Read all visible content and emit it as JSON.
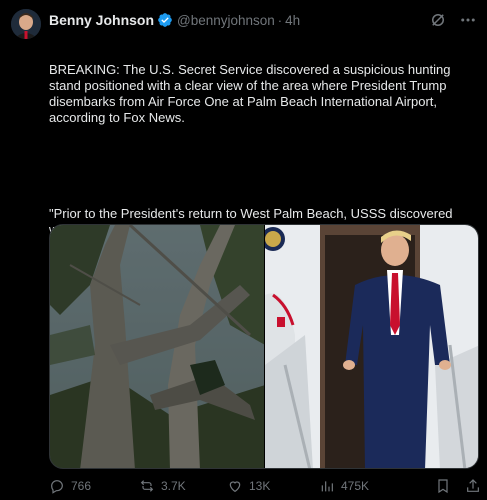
{
  "author": {
    "name": "Benny Johnson",
    "handle": "@bennyjohnson",
    "time": "4h",
    "verified": true
  },
  "text": {
    "paragraph1": "BREAKING: The U.S. Secret Service discovered a suspicious hunting stand positioned with a clear view of the area where President Trump disembarks from Air Force One at Palm Beach International Airport, according to Fox News.",
    "paragraph2": "\"Prior to the President's return to West Palm Beach, USSS discovered what appeared to be an elevated hunting stand within sight line of the Air Force One landing zone,\" Patel told Fox News Digital. \"No individuals were located at the scene. The FBI has since taken the investigatory lead, flying in resources to collect all evidence from the scene, and deploying our cell phone analytics capabilities.\""
  },
  "media": [
    {
      "icon": "tree-photo"
    },
    {
      "icon": "air-force-one-stairs-photo"
    }
  ],
  "stats": {
    "replies": "766",
    "reposts": "3.7K",
    "likes": "13K",
    "views": "475K"
  },
  "colors": {
    "background": "#000000",
    "text": "#e7e9ea",
    "muted": "#71767b",
    "verified": "#1d9bf0"
  }
}
